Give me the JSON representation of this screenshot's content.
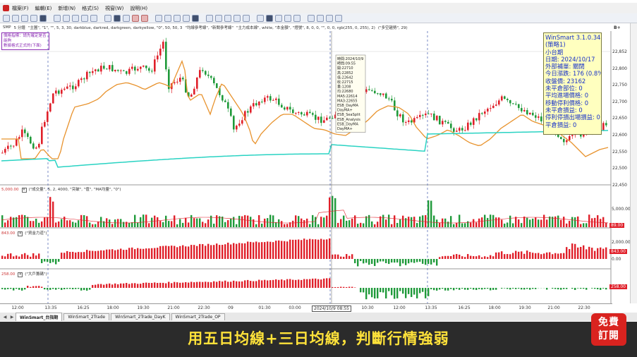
{
  "menu": {
    "items": [
      "檔案(F)",
      "編輯(E)",
      "新增(N)",
      "格式(S)",
      "視窗(W)",
      "說明(H)"
    ]
  },
  "toolbar": {
    "count": 40
  },
  "settings_line": {
    "left": "SMP",
    "mid": "5 分鐘",
    "study": "\"主圖\", \"1\", \"\", 5, 3, 30, darkblue, darkred, darkgreen, darkyellow, \"0\", 50, 50, 3",
    "study2": "\"均線參考線\", \"新聞參考線\"",
    "study3": "\"主力成本線\", white, \"本金額\", \"燈號\", 8, 0, 0, \"\", 0, 0, rgb(255, 0, 255), 2)",
    "study4": "(\"多空趨勢\", 29)"
  },
  "note_box": {
    "line1": "價格指標：請先確定是否能夠",
    "line2": "數據格式正式的(下面)"
  },
  "info_panel": {
    "title": "WinSmart 3.1.0.34",
    "strategy": "(策略1)",
    "symbol": "小台期",
    "date": "日期: 2024/10/17",
    "rule": "外部補單: 關閉",
    "change": "今日漲跌: 176 (0.8%)",
    "close": "收盤價: 23162",
    "position": "未平倉部位: 0",
    "avg_exit": "平均進場價格: 0",
    "trail": "移動停利價格: 0",
    "unrealized": "未平倉損益: 0",
    "stop": "停利停損出場損益: 0",
    "realized": "平倉損益: 0"
  },
  "price_axis": [
    "22,852",
    "22,800",
    "22,750",
    "22,700",
    "22,650",
    "22,600",
    "22,550",
    "22,500",
    "22,450"
  ],
  "price_axis_top": "B+",
  "volume_pane": {
    "label_value": "5,000.00",
    "label_text": "(\"成交量\", 5, 2, 4000, \"突破\", \"值\", \"MA均量\", \"0\")",
    "axis_high": "5,000.00",
    "axis_current": "89.00"
  },
  "pane2": {
    "label_value": "843.00",
    "label_text": "(\"資金力道\")",
    "axis_high": "2,000.00",
    "axis_current": "843.00",
    "axis_zero": "0.00"
  },
  "pane3": {
    "label_value": "258.00",
    "label_text": "(\"大戶籌碼\")",
    "axis_current": "258.00"
  },
  "time_axis": {
    "labels": [
      "12:00",
      "13:35",
      "16:25",
      "18:00",
      "19:30",
      "21:00",
      "22:30",
      "09",
      "01:30",
      "03:00",
      "10:30",
      "12:00",
      "13:35",
      "16:25",
      "18:00",
      "19:30",
      "21:00",
      "22:30"
    ],
    "cursor_label": "2024/10/9 08:55"
  },
  "crosshair_popup": {
    "lines": [
      "時間:2024/10/9",
      "時間:09:55",
      "開:22710",
      "高:22852",
      "低:22642",
      "收:22715",
      "量:1208",
      "均:22680",
      "MA5:22614",
      "MA3:22655",
      "ESB_DayMA",
      "DayMA+",
      "ESB_SeaSplit",
      "ESB_Analysis",
      "ESB_DayMA",
      "DayMA+"
    ]
  },
  "tabs": [
    "WinSmart_台指期",
    "WinSmart_2Trade",
    "WinSmart_2Trade_DayK",
    "WinSmart_2Trade_OP"
  ],
  "banner": {
    "text": "用五日均線+三日均線，判斷行情強弱"
  },
  "subscribe": {
    "line1": "免費",
    "line2": "訂閱"
  },
  "colors": {
    "up": "#e0202a",
    "down": "#1f9a3a",
    "ma5": "#e8932e",
    "ma3": "#2ad3c3",
    "banner_text": "#ffe23a",
    "info_text": "#1630c8",
    "subscribe_bg": "#d9231f"
  },
  "icons": [
    "close-icon",
    "tab-arrow-left-icon",
    "tab-arrow-right-icon"
  ]
}
